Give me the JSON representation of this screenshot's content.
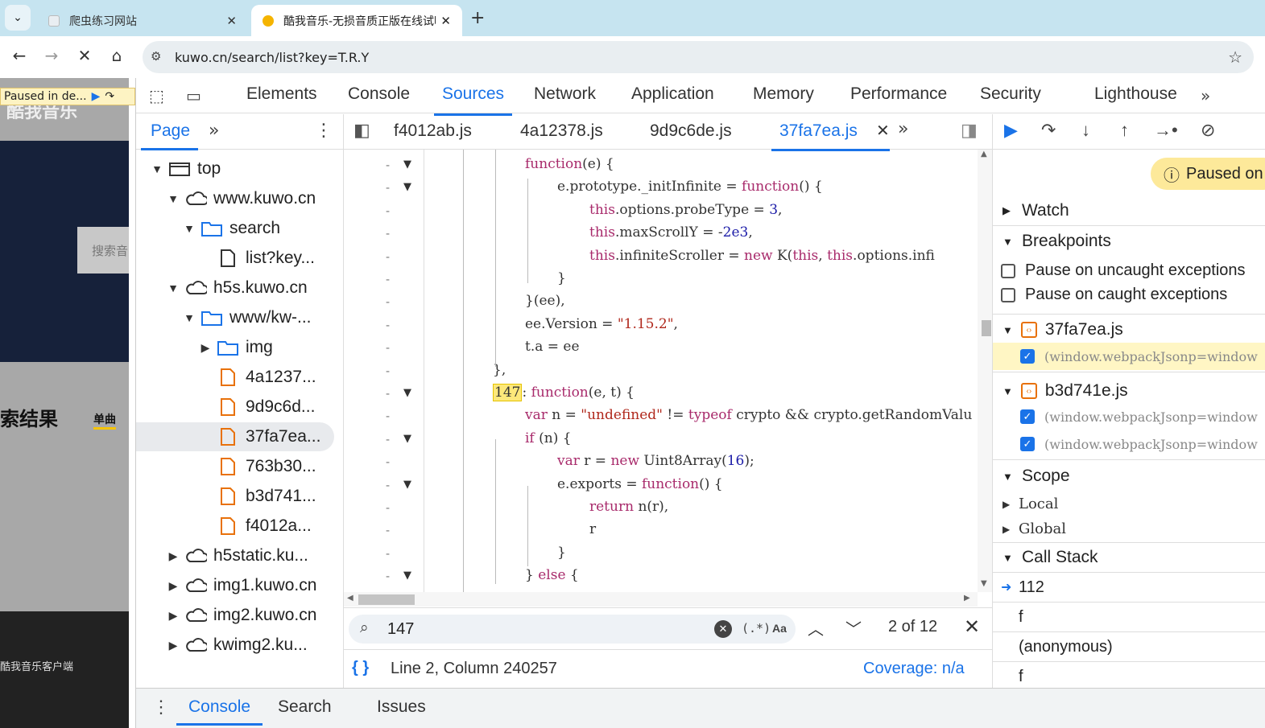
{
  "browser": {
    "tabs": [
      {
        "title": "爬虫练习网站",
        "active": false
      },
      {
        "title": "酷我音乐-无损音质正版在线试听",
        "active": true
      }
    ],
    "url": "kuwo.cn/search/list?key=T.R.Y"
  },
  "page": {
    "paused_badge": "Paused in de...",
    "logo_text": "酷我音乐",
    "search_placeholder": "搜索音",
    "result_title": "索结果",
    "single_tab": "单曲",
    "footer_text": "酷我音乐客户端"
  },
  "devtools": {
    "tabs": [
      "Elements",
      "Console",
      "Sources",
      "Network",
      "Application",
      "Memory",
      "Performance",
      "Security",
      "Lighthouse"
    ],
    "active_tab": "Sources",
    "navigator": {
      "tab": "Page",
      "tree": [
        {
          "label": "top",
          "icon": "frame-icon",
          "depth": 0,
          "state": "open"
        },
        {
          "label": "www.kuwo.cn",
          "icon": "cloud-icon",
          "depth": 1,
          "state": "open"
        },
        {
          "label": "search",
          "icon": "folder-icon",
          "depth": 2,
          "state": "open"
        },
        {
          "label": "list?key...",
          "icon": "document-icon",
          "depth": 3,
          "state": "leaf"
        },
        {
          "label": "h5s.kuwo.cn",
          "icon": "cloud-icon",
          "depth": 1,
          "state": "open"
        },
        {
          "label": "www/kw-...",
          "icon": "folder-icon",
          "depth": 2,
          "state": "open"
        },
        {
          "label": "img",
          "icon": "folder-icon",
          "depth": 3,
          "state": "closed"
        },
        {
          "label": "4a1237...",
          "icon": "script-file-icon",
          "depth": 3,
          "state": "leaf"
        },
        {
          "label": "9d9c6d...",
          "icon": "script-file-icon",
          "depth": 3,
          "state": "leaf"
        },
        {
          "label": "37fa7ea...",
          "icon": "script-file-icon",
          "depth": 3,
          "state": "leaf",
          "selected": true
        },
        {
          "label": "763b30...",
          "icon": "script-file-icon",
          "depth": 3,
          "state": "leaf"
        },
        {
          "label": "b3d741...",
          "icon": "script-file-icon",
          "depth": 3,
          "state": "leaf"
        },
        {
          "label": "f4012a...",
          "icon": "script-file-icon",
          "depth": 3,
          "state": "leaf"
        },
        {
          "label": "h5static.ku...",
          "icon": "cloud-icon",
          "depth": 1,
          "state": "closed"
        },
        {
          "label": "img1.kuwo.cn",
          "icon": "cloud-icon",
          "depth": 1,
          "state": "closed"
        },
        {
          "label": "img2.kuwo.cn",
          "icon": "cloud-icon",
          "depth": 1,
          "state": "closed"
        },
        {
          "label": "kwimg2.ku...",
          "icon": "cloud-icon",
          "depth": 1,
          "state": "closed"
        }
      ]
    },
    "editor": {
      "file_tabs": [
        "f4012ab.js",
        "4a12378.js",
        "9d9c6de.js",
        "37fa7ea.js"
      ],
      "active_file": "37fa7ea.js",
      "code_lines": [
        {
          "indent": 1,
          "html": "function(e) {",
          "marker": "-",
          "fold": true
        },
        {
          "indent": 2,
          "html": "e.prototype._initInfinite = function() {",
          "marker": "-",
          "fold": true
        },
        {
          "indent": 3,
          "html": "this.options.probeType = 3,",
          "marker": "-"
        },
        {
          "indent": 3,
          "html": "this.maxScrollY = -2e3,",
          "marker": "-"
        },
        {
          "indent": 3,
          "html": "this.infiniteScroller = new K(this, this.options.infi",
          "marker": "-"
        },
        {
          "indent": 2,
          "html": "}",
          "marker": "-"
        },
        {
          "indent": 1,
          "html": "}(ee),",
          "marker": "-"
        },
        {
          "indent": 1,
          "html": "ee.Version = \"1.15.2\",",
          "marker": "-"
        },
        {
          "indent": 1,
          "html": "t.a = ee",
          "marker": "-"
        },
        {
          "indent": 0,
          "html": "},",
          "marker": "-"
        },
        {
          "indent": 0,
          "html": "147: function(e, t) {",
          "marker": "-",
          "fold": true
        },
        {
          "indent": 1,
          "html": "var n = \"undefined\" != typeof crypto && crypto.getRandomValu",
          "marker": "-"
        },
        {
          "indent": 1,
          "html": "if (n) {",
          "marker": "-",
          "fold": true
        },
        {
          "indent": 2,
          "html": "var r = new Uint8Array(16);",
          "marker": "-"
        },
        {
          "indent": 2,
          "html": "e.exports = function() {",
          "marker": "-",
          "fold": true
        },
        {
          "indent": 3,
          "html": "return n(r),",
          "marker": "-"
        },
        {
          "indent": 3,
          "html": "r",
          "marker": "-"
        },
        {
          "indent": 2,
          "html": "}",
          "marker": "-"
        },
        {
          "indent": 1,
          "html": "} else {",
          "marker": "-",
          "fold": true
        }
      ],
      "search": {
        "query": "147",
        "regex_label": "(.*)",
        "case_label": "Aa",
        "match_count": "2 of 12"
      },
      "status": {
        "braces": "{ }",
        "position": "Line 2, Column 240257",
        "coverage": "Coverage: n/a"
      }
    },
    "debugger": {
      "paused_label": "Paused on",
      "sections": {
        "watch": "Watch",
        "breakpoints": "Breakpoints",
        "scope": "Scope",
        "call_stack": "Call Stack"
      },
      "exception_options": [
        {
          "label": "Pause on uncaught exceptions",
          "checked": false
        },
        {
          "label": "Pause on caught exceptions",
          "checked": false
        }
      ],
      "breakpoint_files": [
        {
          "file": "37fa7ea.js",
          "lines": [
            {
              "text": "(window.webpackJsonp=window",
              "checked": true,
              "current": true
            }
          ]
        },
        {
          "file": "b3d741e.js",
          "lines": [
            {
              "text": "(window.webpackJsonp=window",
              "checked": true
            },
            {
              "text": "(window.webpackJsonp=window",
              "checked": true
            }
          ]
        }
      ],
      "scope_items": [
        "Local",
        "Global"
      ],
      "call_stack": [
        {
          "label": "112",
          "current": true
        },
        {
          "label": "f"
        },
        {
          "label": "(anonymous)"
        },
        {
          "label": "f"
        }
      ]
    },
    "drawer": {
      "tabs": [
        "Console",
        "Search",
        "Issues"
      ],
      "active": "Console"
    }
  },
  "colors": {
    "accent": "#1a73e8",
    "tabstrip": "#c6e4f0",
    "paused": "#fde99a",
    "keyword": "#a82a6b",
    "string": "#b0281c",
    "number": "#1c1ca8"
  }
}
